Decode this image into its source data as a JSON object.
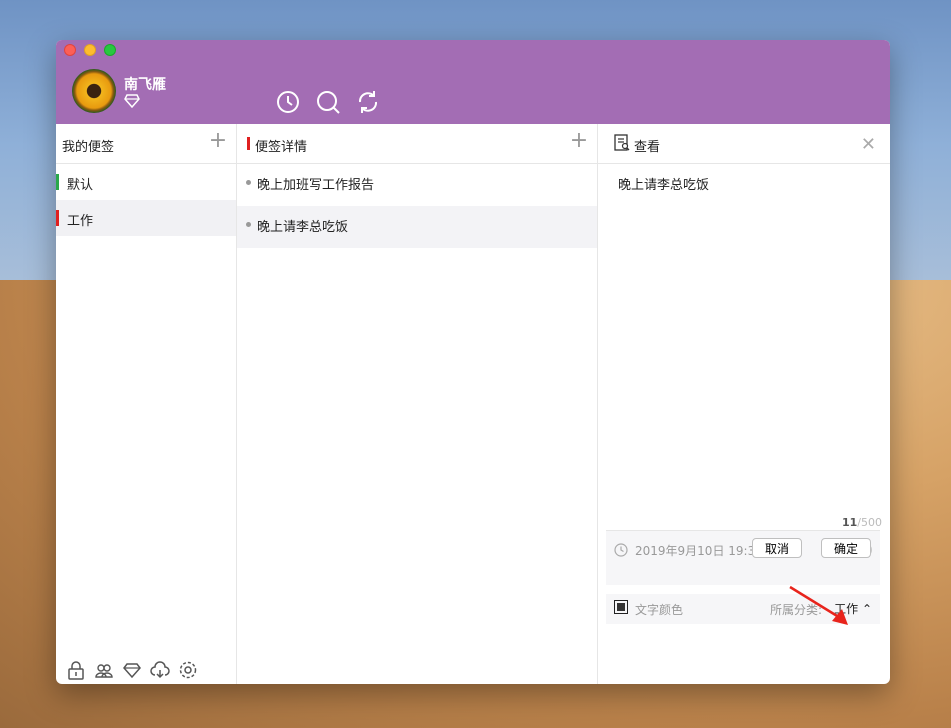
{
  "user": {
    "name": "南飞雁"
  },
  "toolbar": {
    "icons": [
      "history-icon",
      "search-icon",
      "sync-icon"
    ]
  },
  "categories": {
    "title": "我的便签",
    "items": [
      {
        "label": "默认",
        "color": "#2aa84a"
      },
      {
        "label": "工作",
        "color": "#e02020"
      }
    ],
    "bottom_icons": [
      "lock-icon",
      "users-icon",
      "gem-icon",
      "cloud-download-icon",
      "settings-icon"
    ]
  },
  "notes": {
    "title": "便签详情",
    "items": [
      {
        "label": "晚上加班写工作报告"
      },
      {
        "label": "晚上请李总吃饭"
      }
    ]
  },
  "viewer": {
    "title": "查看",
    "content": "晚上请李总吃饭",
    "count": "11",
    "max": "/500",
    "datetime": "2019年9月10日 19:30",
    "text_color_label": "文字颜色",
    "category_label": "所属分类:",
    "category_value": "工作",
    "cancel_label": "取消",
    "ok_label": "确定"
  },
  "colors": {
    "header": "#a36db4",
    "selected_accent": "#e02020",
    "default_accent": "#2aa84a"
  }
}
